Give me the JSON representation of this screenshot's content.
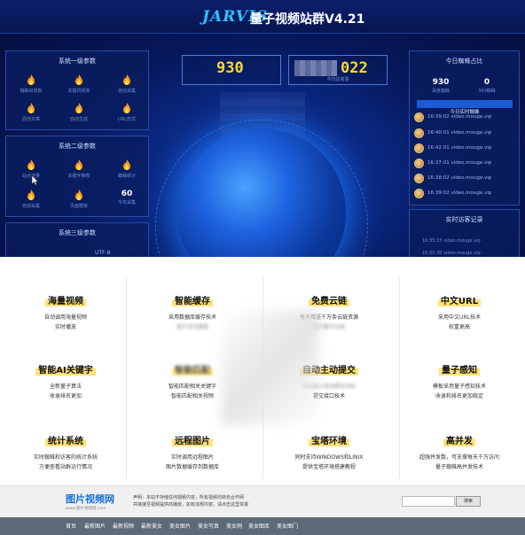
{
  "header": {
    "logo": "JARVIS",
    "title": "量子视频站群V4.21"
  },
  "left_panels": [
    {
      "title": "系统一级参数",
      "items": [
        "蜘蛛出现数",
        "关键词频率",
        "自动采集",
        "原创文章",
        "自动生成",
        "URL形式"
      ]
    },
    {
      "title": "系统二级参数",
      "items": [
        "站点流量",
        "关键字推荐",
        "蜘蛛统计",
        "自动采集",
        "页面模板"
      ],
      "stat": {
        "value": "60",
        "label": "今日采集"
      }
    },
    {
      "title": "系统三级参数",
      "bottom_text": "UTF-8"
    }
  ],
  "counters": {
    "left_value": "930",
    "right_value": "022",
    "right_label": "今日总收录"
  },
  "right_panel": {
    "title": "今日蜘蛛占比",
    "stats": [
      {
        "value": "930",
        "label": "百度蜘蛛"
      },
      {
        "value": "0",
        "label": "360蜘蛛"
      }
    ],
    "live_title": "今日实时蜘蛛",
    "live_items": [
      "16:39:02 video.mouge.vip",
      "16:40:01 video.mouge.vip",
      "16:42:01 video.mouge.vip",
      "16:37:01 video.mouge.vip",
      "16:38:02 video.mouge.vip",
      "16:39:02 video.mouge.vip"
    ],
    "visit_title": "实时访客记录",
    "visit_items": [
      "16:35:15 video.mouge.vip",
      "16:35:30 video.mouge.vip"
    ]
  },
  "features": [
    {
      "title": "海量视频",
      "lines": [
        "自动调用海量视频",
        "实时播放"
      ]
    },
    {
      "title": "智能缓存",
      "lines": [
        "采用数据库缓存技术",
        "提升访问速度"
      ]
    },
    {
      "title": "免费云链",
      "lines": [
        "每天赠送千万条云链资源",
        "提升量子云链"
      ]
    },
    {
      "title": "中文URL",
      "lines": [
        "采用中文URL技术",
        "权重更高"
      ]
    },
    {
      "title": "智能AI关键字",
      "lines": [
        "全新量子算法",
        "收录排名更加"
      ]
    },
    {
      "title": "智能匹配",
      "lines": [
        "智能匹配相关关键字",
        "智能匹配相关视频"
      ]
    },
    {
      "title": "自动主动提交",
      "lines": [
        "可以加入自动提交代码",
        "提交接口技术"
      ]
    },
    {
      "title": "量子感知",
      "lines": [
        "模板采用量子感知技术",
        "收录和排名更加稳定"
      ]
    },
    {
      "title": "统计系统",
      "lines": [
        "实时蜘蛛和访客的统计系统",
        "方便查看站群运行情况"
      ]
    },
    {
      "title": "远程图片",
      "lines": [
        "实时调用远程图片",
        "图片数据缓存到数据库"
      ]
    },
    {
      "title": "宝塔环境",
      "lines": [
        "同时支持WINDOWS和LINIX",
        "提供宝塔环境搭建教程"
      ]
    },
    {
      "title": "高并发",
      "lines": [
        "超强并发数，可支撑每天千万访问",
        "量子蜘蛛高并发技术"
      ]
    }
  ],
  "footer": {
    "logo": "图片视频网",
    "logo_sub": "www.图片视频网.com",
    "notice_line1": "声明：本站不存储任何视频内容，所有视频均转自合作网",
    "notice_line2": "并链接至视频提供商播放，如有违规内容，请点击这里举报",
    "search_button": "搜索"
  },
  "nav": [
    "首页",
    "最新图片",
    "最新视频",
    "最新美女",
    "美女图片",
    "美女写真",
    "美女网",
    "美女图库",
    "美女图门"
  ]
}
